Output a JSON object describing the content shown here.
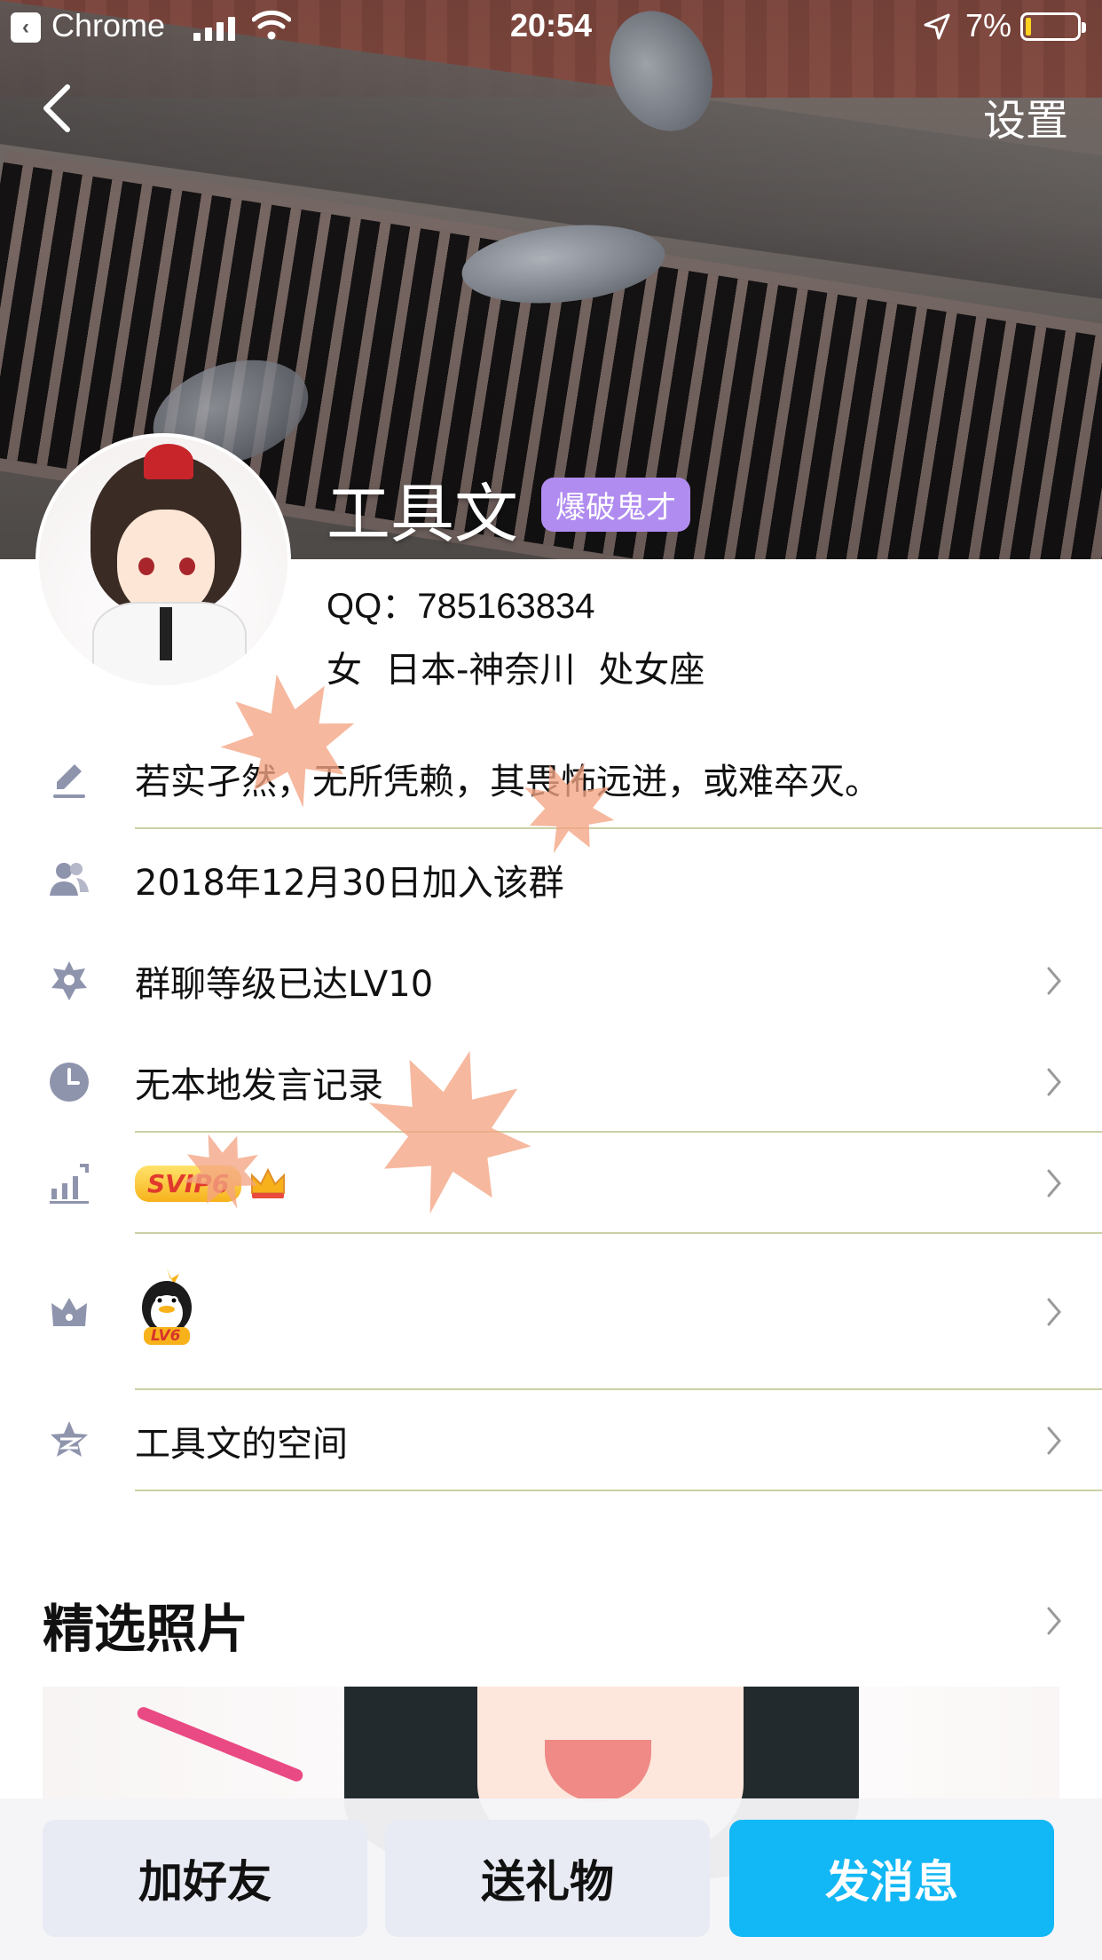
{
  "status_bar": {
    "back_app": "Chrome",
    "time": "20:54",
    "battery_pct": "7%",
    "battery_level": 0.07,
    "colors": {
      "battery_fill": "#ffd21f"
    }
  },
  "header": {
    "settings_label": "设置"
  },
  "profile": {
    "name": "工具文",
    "badge": "爆破鬼才",
    "qq_line": "QQ：785163834",
    "gender": "女",
    "location": "日本-神奈川",
    "zodiac": "处女座"
  },
  "list": {
    "signature": "若实孑然，无所凭赖，其畏怖远迸，或难卒灭。",
    "joined": "2018年12月30日加入该群",
    "group_level": "群聊等级已达LV10",
    "speech_record": "无本地发言记录",
    "svip_tag": "SVIP6",
    "qq_level_tag": "LV6",
    "space": "工具文的空间"
  },
  "featured": {
    "title": "精选照片"
  },
  "actions": {
    "add_friend": "加好友",
    "send_gift": "送礼物",
    "send_message": "发消息"
  },
  "icons": {
    "edit": "pencil-icon",
    "members": "people-icon",
    "level": "star-badge-icon",
    "history": "clock-icon",
    "growth": "bar-chart-icon",
    "vip": "crown-icon",
    "space": "star-icon",
    "chevron": "chevron-right-icon"
  },
  "colors": {
    "accent": "#12b7f5",
    "badge": "#b18cf0",
    "divider": "#ccd0a6",
    "icon": "#8f94ad"
  }
}
